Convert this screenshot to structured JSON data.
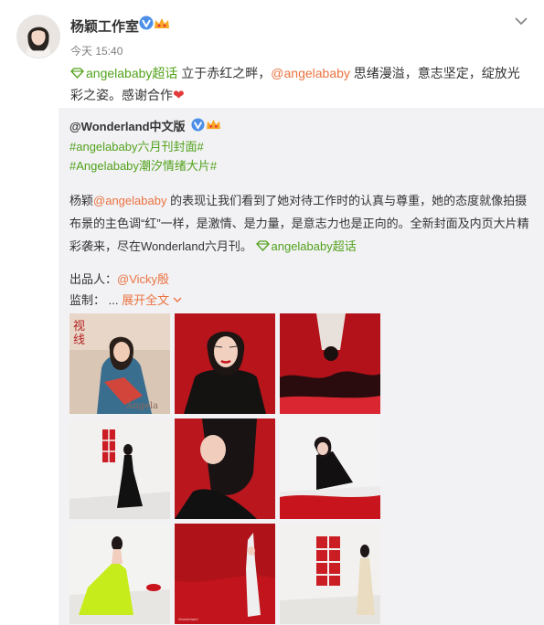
{
  "post": {
    "author": "杨颖工作室",
    "timestamp": "今天 15:40",
    "text": {
      "supertopic": "angelababy超话",
      "part1": " 立于赤红之畔，",
      "mention": "@angelababy",
      "part2": " 思绪漫溢，意志坚定，绽放光彩之姿。感谢合作",
      "heart": "❤"
    }
  },
  "repost": {
    "author": "@Wonderland中文版",
    "hashtags": [
      "#angelababy六月刊封面#",
      "#Angelababy潮汐情绪大片#"
    ],
    "body": {
      "prefix": "杨颖",
      "mention": "@angelababy",
      "text": " 的表现让我们看到了她对待工作时的认真与尊重，她的态度就像拍摄布景的主色调“红”一样，是激情、是力量，是意志力也是正向的。全新封面及内页大片精彩袭来，尽在Wonderland六月刊。",
      "supertopic": "angelababy超话"
    },
    "producer_label": "出品人：",
    "producer_mention": "@Vicky殷",
    "supervisor_label": "监制：",
    "ellipsis": "...",
    "expand": "展开全文",
    "images": [
      {
        "name": "photo-1",
        "caption_top": "视\n线",
        "caption_bottom": "Angela"
      },
      {
        "name": "photo-2"
      },
      {
        "name": "photo-3"
      },
      {
        "name": "photo-4"
      },
      {
        "name": "photo-5"
      },
      {
        "name": "photo-6"
      },
      {
        "name": "photo-7"
      },
      {
        "name": "photo-8"
      },
      {
        "name": "photo-9"
      }
    ]
  },
  "colors": {
    "link_orange": "#eb7340",
    "topic_green": "#52a21b",
    "repost_bg": "#f2f2f5",
    "accent_red": "#c8101e"
  }
}
